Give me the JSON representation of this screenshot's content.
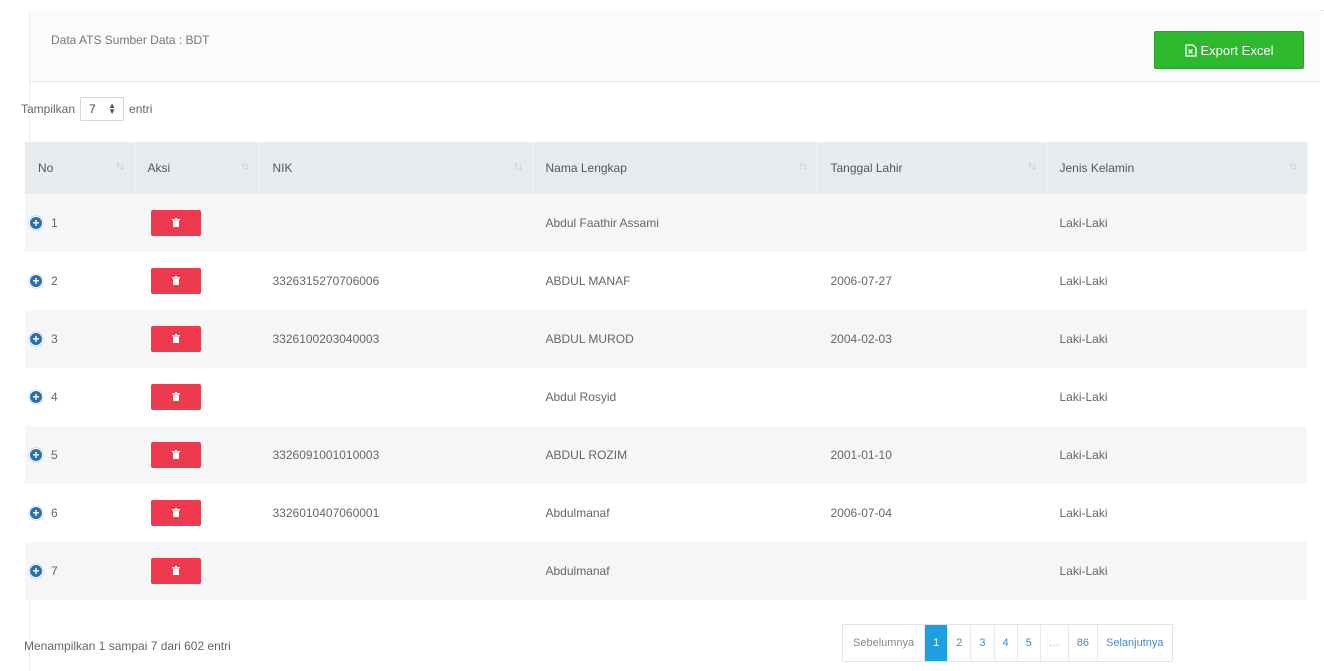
{
  "header": {
    "title": "Data ATS Sumber Data : BDT",
    "export_label": "Export Excel"
  },
  "length": {
    "prefix": "Tampilkan",
    "value": "7",
    "suffix": "entri"
  },
  "table": {
    "columns": [
      "No",
      "Aksi",
      "NIK",
      "Nama Lengkap",
      "Tanggal Lahir",
      "Jenis Kelamin"
    ],
    "rows": [
      {
        "no": "1",
        "nik": "",
        "nama": "Abdul Faathir Assami",
        "tgl": "",
        "jk": "Laki-Laki"
      },
      {
        "no": "2",
        "nik": "3326315270706006",
        "nama": "ABDUL MANAF",
        "tgl": "2006-07-27",
        "jk": "Laki-Laki"
      },
      {
        "no": "3",
        "nik": "3326100203040003",
        "nama": "ABDUL MUROD",
        "tgl": "2004-02-03",
        "jk": "Laki-Laki"
      },
      {
        "no": "4",
        "nik": "",
        "nama": "Abdul Rosyid",
        "tgl": "",
        "jk": "Laki-Laki"
      },
      {
        "no": "5",
        "nik": "3326091001010003",
        "nama": "ABDUL ROZIM",
        "tgl": "2001-01-10",
        "jk": "Laki-Laki"
      },
      {
        "no": "6",
        "nik": "3326010407060001",
        "nama": "Abdulmanaf",
        "tgl": "2006-07-04",
        "jk": "Laki-Laki"
      },
      {
        "no": "7",
        "nik": "",
        "nama": "Abdulmanaf",
        "tgl": "",
        "jk": "Laki-Laki"
      }
    ]
  },
  "footer": {
    "info": "Menampilkan 1 sampai 7 dari 602 entri"
  },
  "pagination": {
    "prev": "Sebelumnya",
    "pages": [
      "1",
      "2",
      "3",
      "4",
      "5",
      "…",
      "86"
    ],
    "active": "1",
    "next": "Selanjutnya"
  },
  "icons": {
    "export": "excel-file-icon",
    "expand": "plus-circle-icon",
    "delete": "trash-icon",
    "sort": "sort-icon"
  },
  "colors": {
    "export_button": "#2eb82e",
    "delete_button": "#ee3a4e",
    "expand_icon": "#2a6db0",
    "pager_active": "#1e9fe0"
  }
}
